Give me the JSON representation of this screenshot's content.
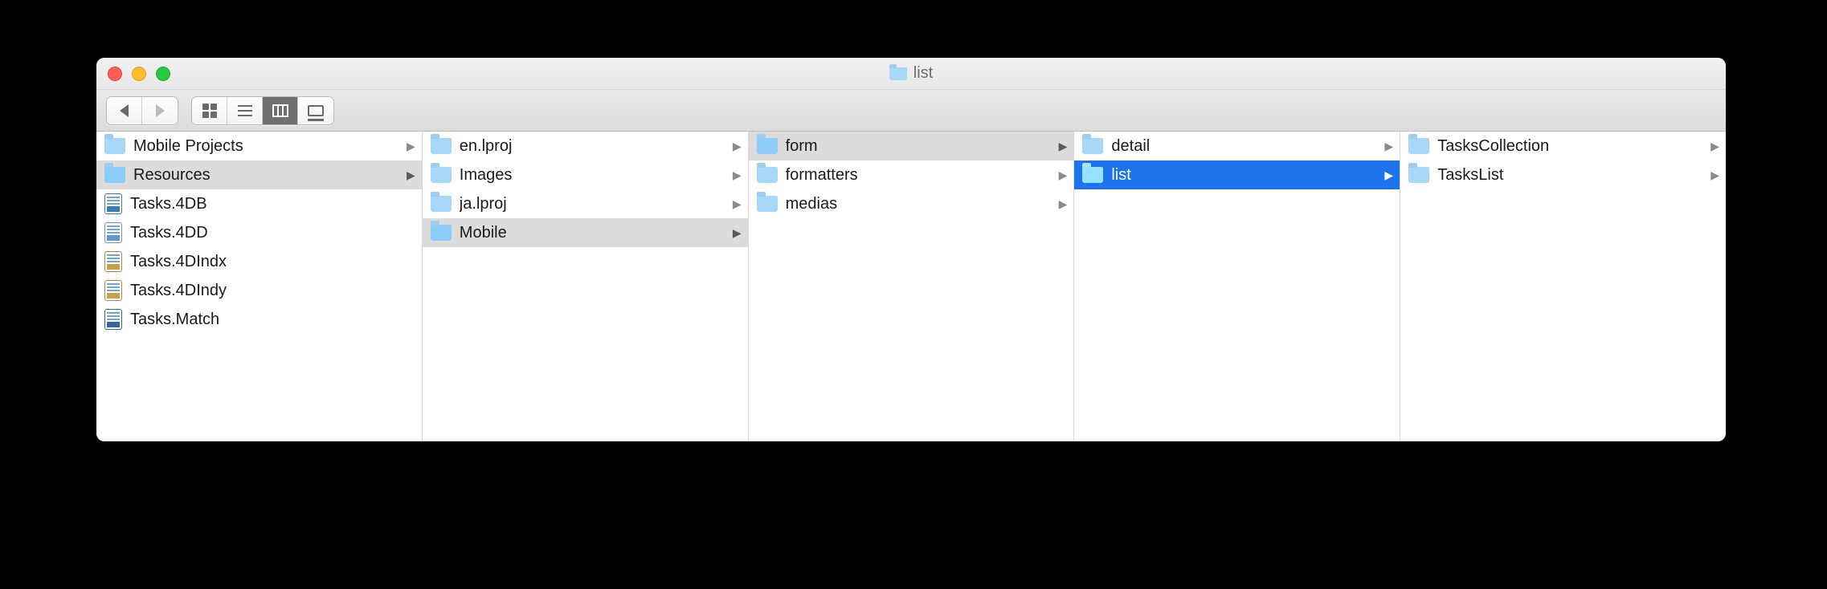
{
  "window": {
    "title": "list"
  },
  "columns": [
    {
      "items": [
        {
          "name": "Mobile Projects",
          "type": "folder",
          "has_children": true,
          "state": "none"
        },
        {
          "name": "Resources",
          "type": "folder",
          "has_children": true,
          "state": "path"
        },
        {
          "name": "Tasks.4DB",
          "type": "file",
          "variant": "db",
          "has_children": false,
          "state": "none"
        },
        {
          "name": "Tasks.4DD",
          "type": "file",
          "variant": "dd",
          "has_children": false,
          "state": "none"
        },
        {
          "name": "Tasks.4DIndx",
          "type": "file",
          "variant": "indx",
          "has_children": false,
          "state": "none"
        },
        {
          "name": "Tasks.4DIndy",
          "type": "file",
          "variant": "indx",
          "has_children": false,
          "state": "none"
        },
        {
          "name": "Tasks.Match",
          "type": "file",
          "variant": "match",
          "has_children": false,
          "state": "none"
        }
      ]
    },
    {
      "items": [
        {
          "name": "en.lproj",
          "type": "folder",
          "has_children": true,
          "state": "none"
        },
        {
          "name": "Images",
          "type": "folder",
          "has_children": true,
          "state": "none"
        },
        {
          "name": "ja.lproj",
          "type": "folder",
          "has_children": true,
          "state": "none"
        },
        {
          "name": "Mobile",
          "type": "folder",
          "has_children": true,
          "state": "path"
        }
      ]
    },
    {
      "items": [
        {
          "name": "form",
          "type": "folder",
          "has_children": true,
          "state": "path"
        },
        {
          "name": "formatters",
          "type": "folder",
          "has_children": true,
          "state": "none"
        },
        {
          "name": "medias",
          "type": "folder",
          "has_children": true,
          "state": "none"
        }
      ]
    },
    {
      "items": [
        {
          "name": "detail",
          "type": "folder",
          "has_children": true,
          "state": "none"
        },
        {
          "name": "list",
          "type": "folder",
          "has_children": true,
          "state": "selected"
        }
      ]
    },
    {
      "items": [
        {
          "name": "TasksCollection",
          "type": "folder",
          "has_children": true,
          "state": "none"
        },
        {
          "name": "TasksList",
          "type": "folder",
          "has_children": true,
          "state": "none"
        }
      ]
    }
  ],
  "toolbar": {
    "back_enabled": true,
    "forward_enabled": false,
    "active_view": "columns"
  }
}
